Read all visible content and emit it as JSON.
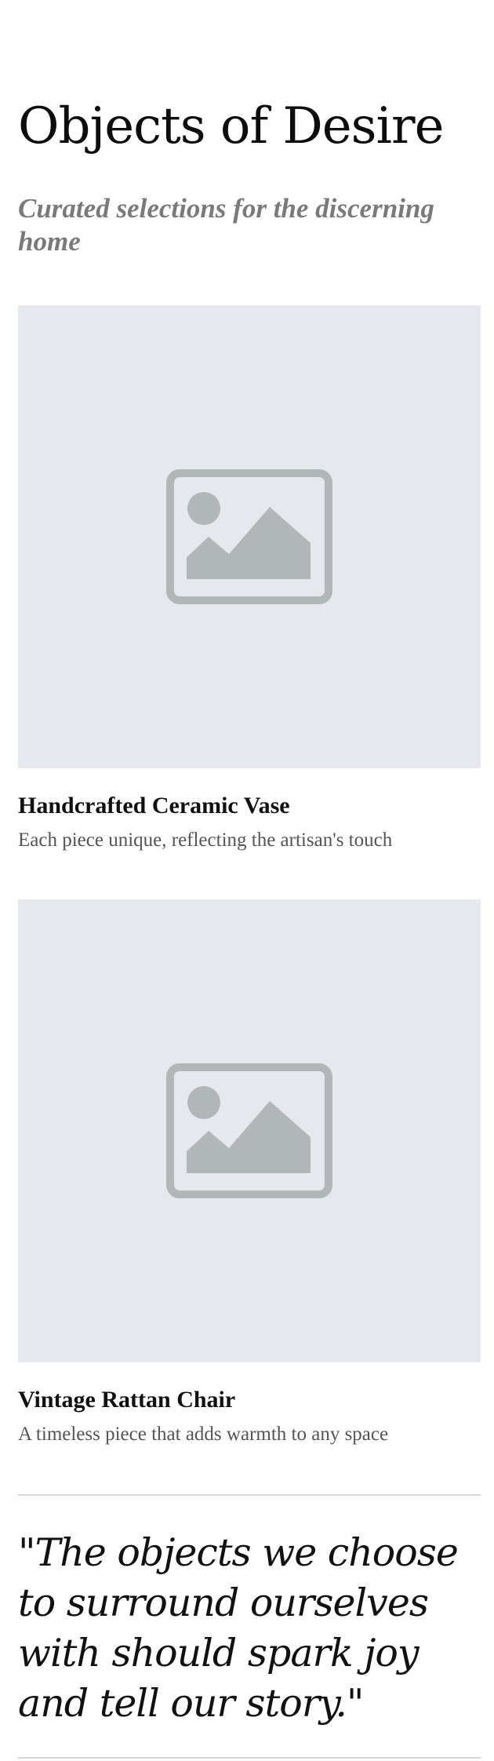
{
  "header": {
    "title": "Objects of Desire",
    "subtitle": "Curated selections for the discerning home"
  },
  "products": [
    {
      "image_icon": "image-placeholder-icon",
      "title": "Handcrafted Ceramic Vase",
      "description": "Each piece unique, reflecting the artisan's touch"
    },
    {
      "image_icon": "image-placeholder-icon",
      "title": "Vintage Rattan Chair",
      "description": "A timeless piece that adds warmth to any space"
    }
  ],
  "quote": {
    "text": "\"The objects we choose to surround ourselves with should spark joy and tell our story.\""
  },
  "colors": {
    "placeholder_bg": "#e5e9ed",
    "placeholder_icon": "#b1b6b9",
    "subtitle": "#7a7a7a",
    "description": "#555555",
    "divider": "#d6d6d6"
  }
}
